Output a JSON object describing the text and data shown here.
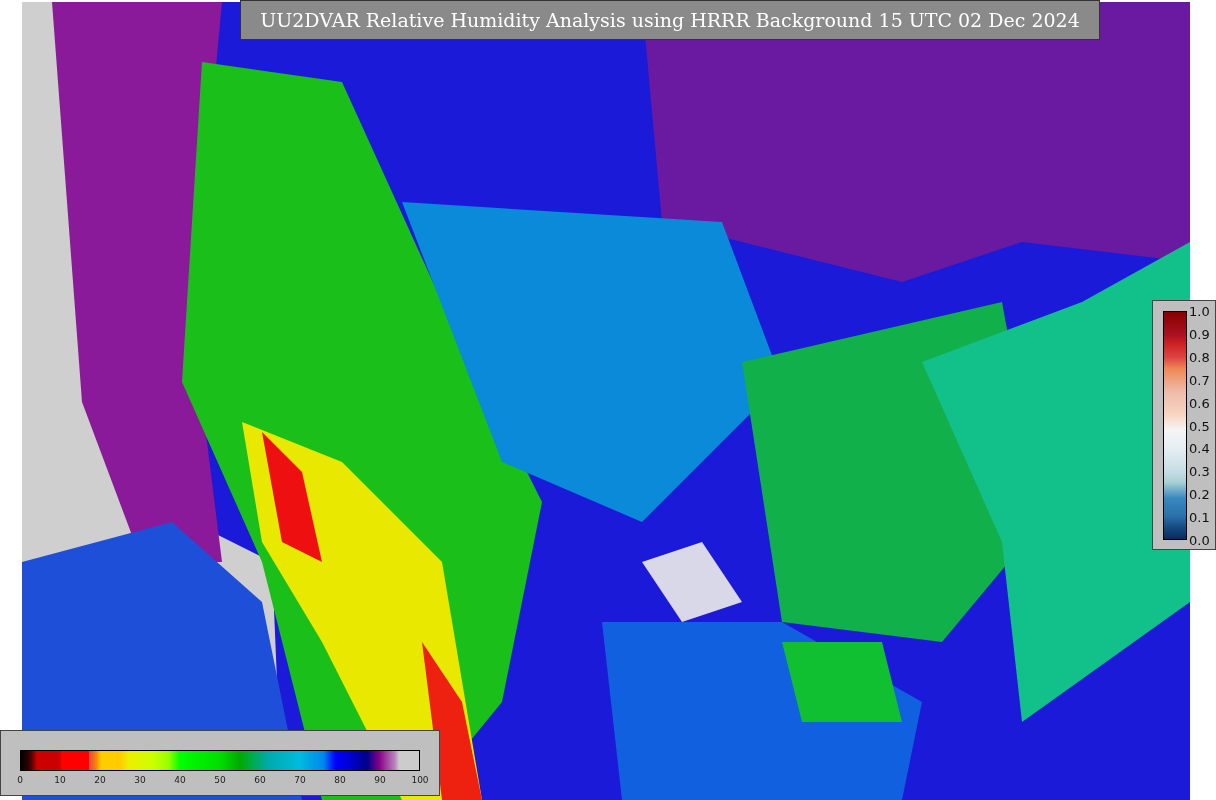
{
  "title": "UU2DVAR Relative Humidity Analysis using HRRR Background 15 UTC 02 Dec 2024",
  "humidity_legend": {
    "ticks": [
      "0",
      "10",
      "20",
      "30",
      "40",
      "50",
      "60",
      "70",
      "80",
      "90",
      "100"
    ]
  },
  "ratio_legend": {
    "ticks": [
      "1.0",
      "0.9",
      "0.8",
      "0.7",
      "0.6",
      "0.5",
      "0.4",
      "0.3",
      "0.2",
      "0.1",
      "0.0"
    ]
  }
}
